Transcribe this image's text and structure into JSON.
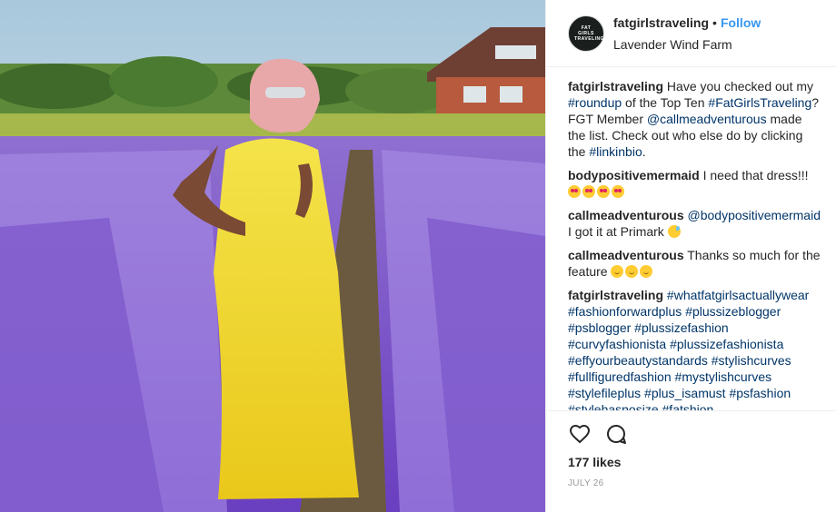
{
  "post": {
    "username": "fatgirlstraveling",
    "separator": "•",
    "follow_label": "Follow",
    "location": "Lavender Wind Farm",
    "avatar_text": "FAT GIRLS TRAVELING",
    "photo_alt": "Woman in yellow dress in lavender field"
  },
  "caption": {
    "user": "fatgirlstraveling",
    "parts": [
      {
        "t": "Have you checked out my "
      },
      {
        "t": "#roundup",
        "tag": true
      },
      {
        "t": " of the Top Ten "
      },
      {
        "t": "#FatGirlsTraveling",
        "tag": true
      },
      {
        "t": "? FGT Member "
      },
      {
        "t": "@callmeadventurous",
        "tag": true
      },
      {
        "t": " made the list. Check out who else do by clicking the "
      },
      {
        "t": "#linkinbio",
        "tag": true
      },
      {
        "t": "."
      }
    ]
  },
  "comments": [
    {
      "user": "bodypositivemermaid",
      "parts": [
        {
          "t": "I need that dress!!!"
        }
      ],
      "emoji": [
        "heart-eyes",
        "heart-eyes",
        "heart-eyes",
        "heart-eyes"
      ]
    },
    {
      "user": "callmeadventurous",
      "parts": [
        {
          "t": "@bodypositivemermaid",
          "tag": true
        },
        {
          "t": " I got it at Primark "
        }
      ],
      "emoji": [
        "sweat"
      ]
    },
    {
      "user": "callmeadventurous",
      "parts": [
        {
          "t": "Thanks so much for the feature "
        }
      ],
      "emoji": [
        "smile",
        "smile",
        "smile"
      ]
    },
    {
      "user": "fatgirlstraveling",
      "parts": [
        {
          "t": "#whatfatgirlsactuallywear",
          "tag": true
        },
        {
          "t": " "
        },
        {
          "t": "#fashionforwardplus",
          "tag": true
        },
        {
          "t": " "
        },
        {
          "t": "#plussizeblogger",
          "tag": true
        },
        {
          "t": " "
        },
        {
          "t": "#psblogger",
          "tag": true
        },
        {
          "t": " "
        },
        {
          "t": "#plussizefashion",
          "tag": true
        },
        {
          "t": " "
        },
        {
          "t": "#curvyfashionista",
          "tag": true
        },
        {
          "t": " "
        },
        {
          "t": "#plussizefashionista",
          "tag": true
        },
        {
          "t": " "
        },
        {
          "t": "#effyourbeautystandards",
          "tag": true
        },
        {
          "t": " "
        },
        {
          "t": "#stylishcurves",
          "tag": true
        },
        {
          "t": " "
        },
        {
          "t": "#fullfiguredfashion",
          "tag": true
        },
        {
          "t": " "
        },
        {
          "t": "#mystylishcurves",
          "tag": true
        },
        {
          "t": " "
        },
        {
          "t": "#stylefileplus",
          "tag": true
        },
        {
          "t": " "
        },
        {
          "t": "#plus_isamust",
          "tag": true
        },
        {
          "t": " "
        },
        {
          "t": "#psfashion",
          "tag": true
        },
        {
          "t": " "
        },
        {
          "t": "#stylehasnosize",
          "tag": true
        },
        {
          "t": " "
        },
        {
          "t": "#fatshion",
          "tag": true
        }
      ],
      "emoji": []
    }
  ],
  "footer": {
    "likes": "177 likes",
    "date": "JULY 26",
    "like_icon": "heart-icon",
    "comment_icon": "comment-icon"
  },
  "colors": {
    "link": "#3897f0",
    "hashtag": "#003569",
    "text": "#262626",
    "muted": "#999999"
  }
}
